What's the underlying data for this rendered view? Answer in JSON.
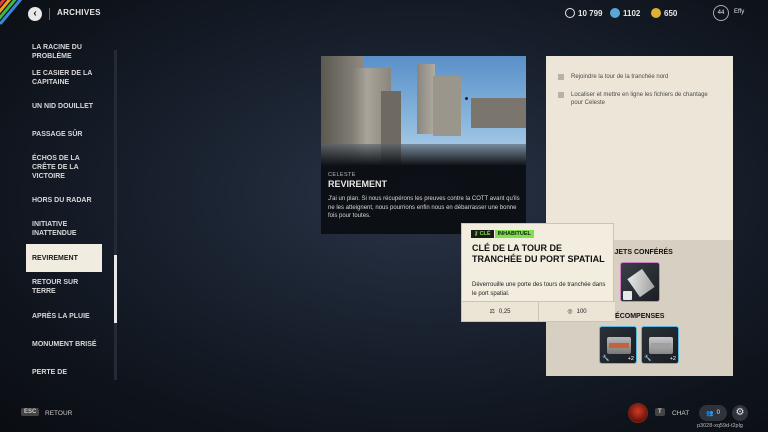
{
  "header": {
    "title": "ARCHIVES",
    "currencies": [
      {
        "icon": "credits-icon",
        "value": "10 799",
        "color": "#e8e8e8"
      },
      {
        "icon": "premium-currency-icon",
        "value": "1102",
        "color": "#5aa8d8"
      },
      {
        "icon": "token-icon",
        "value": "650",
        "color": "#e0b030"
      }
    ],
    "player": {
      "level": "44",
      "name": "Effy"
    }
  },
  "missions": [
    "LA RACINE DU PROBLÈME",
    "LE CASIER DE LA CAPITAINE",
    "UN NID DOUILLET",
    "PASSAGE SÛR",
    "ÉCHOS DE LA CRÊTE DE LA VICTOIRE",
    "HORS DU RADAR",
    "INITIATIVE INATTENDUE",
    "REVIREMENT",
    "RETOUR SUR TERRE",
    "APRÈS LA PLUIE",
    "MONUMENT BRISÉ",
    "PERTE DE"
  ],
  "active_mission_index": 7,
  "mission_detail": {
    "character": "CELESTE",
    "name": "REVIREMENT",
    "description": "J'ai un plan. Si nous récupérons les preuves contre la COTT avant qu'ils ne les atteignent, nous pourrions enfin nous en débarrasser une bonne fois pour toutes."
  },
  "objectives": [
    "Rejoindre la tour de la tranchée nord",
    "Localiser et mettre en ligne les fichiers de chantage pour Celeste"
  ],
  "rewards": {
    "granted_label": "OBJETS CONFÉRÉS",
    "rewards_label": "RÉCOMPENSES",
    "reward_items": [
      {
        "bonus": "+2"
      },
      {
        "bonus": "+2"
      }
    ]
  },
  "tooltip": {
    "tag_key": "CLÉ",
    "tag_rarity": "INHABITUEL",
    "title": "CLÉ DE LA TOUR DE TRANCHÉE DU PORT SPATIAL",
    "description": "Déverrouille une porte des tours de tranchée dans le port spatial.",
    "weight": "0,25",
    "value": "100"
  },
  "footer": {
    "back_key": "ESC",
    "back_label": "RETOUR",
    "chat_key": "T",
    "chat_label": "CHAT",
    "friends_count": "0",
    "build_id": "p3028-xq59d-t2plg"
  }
}
